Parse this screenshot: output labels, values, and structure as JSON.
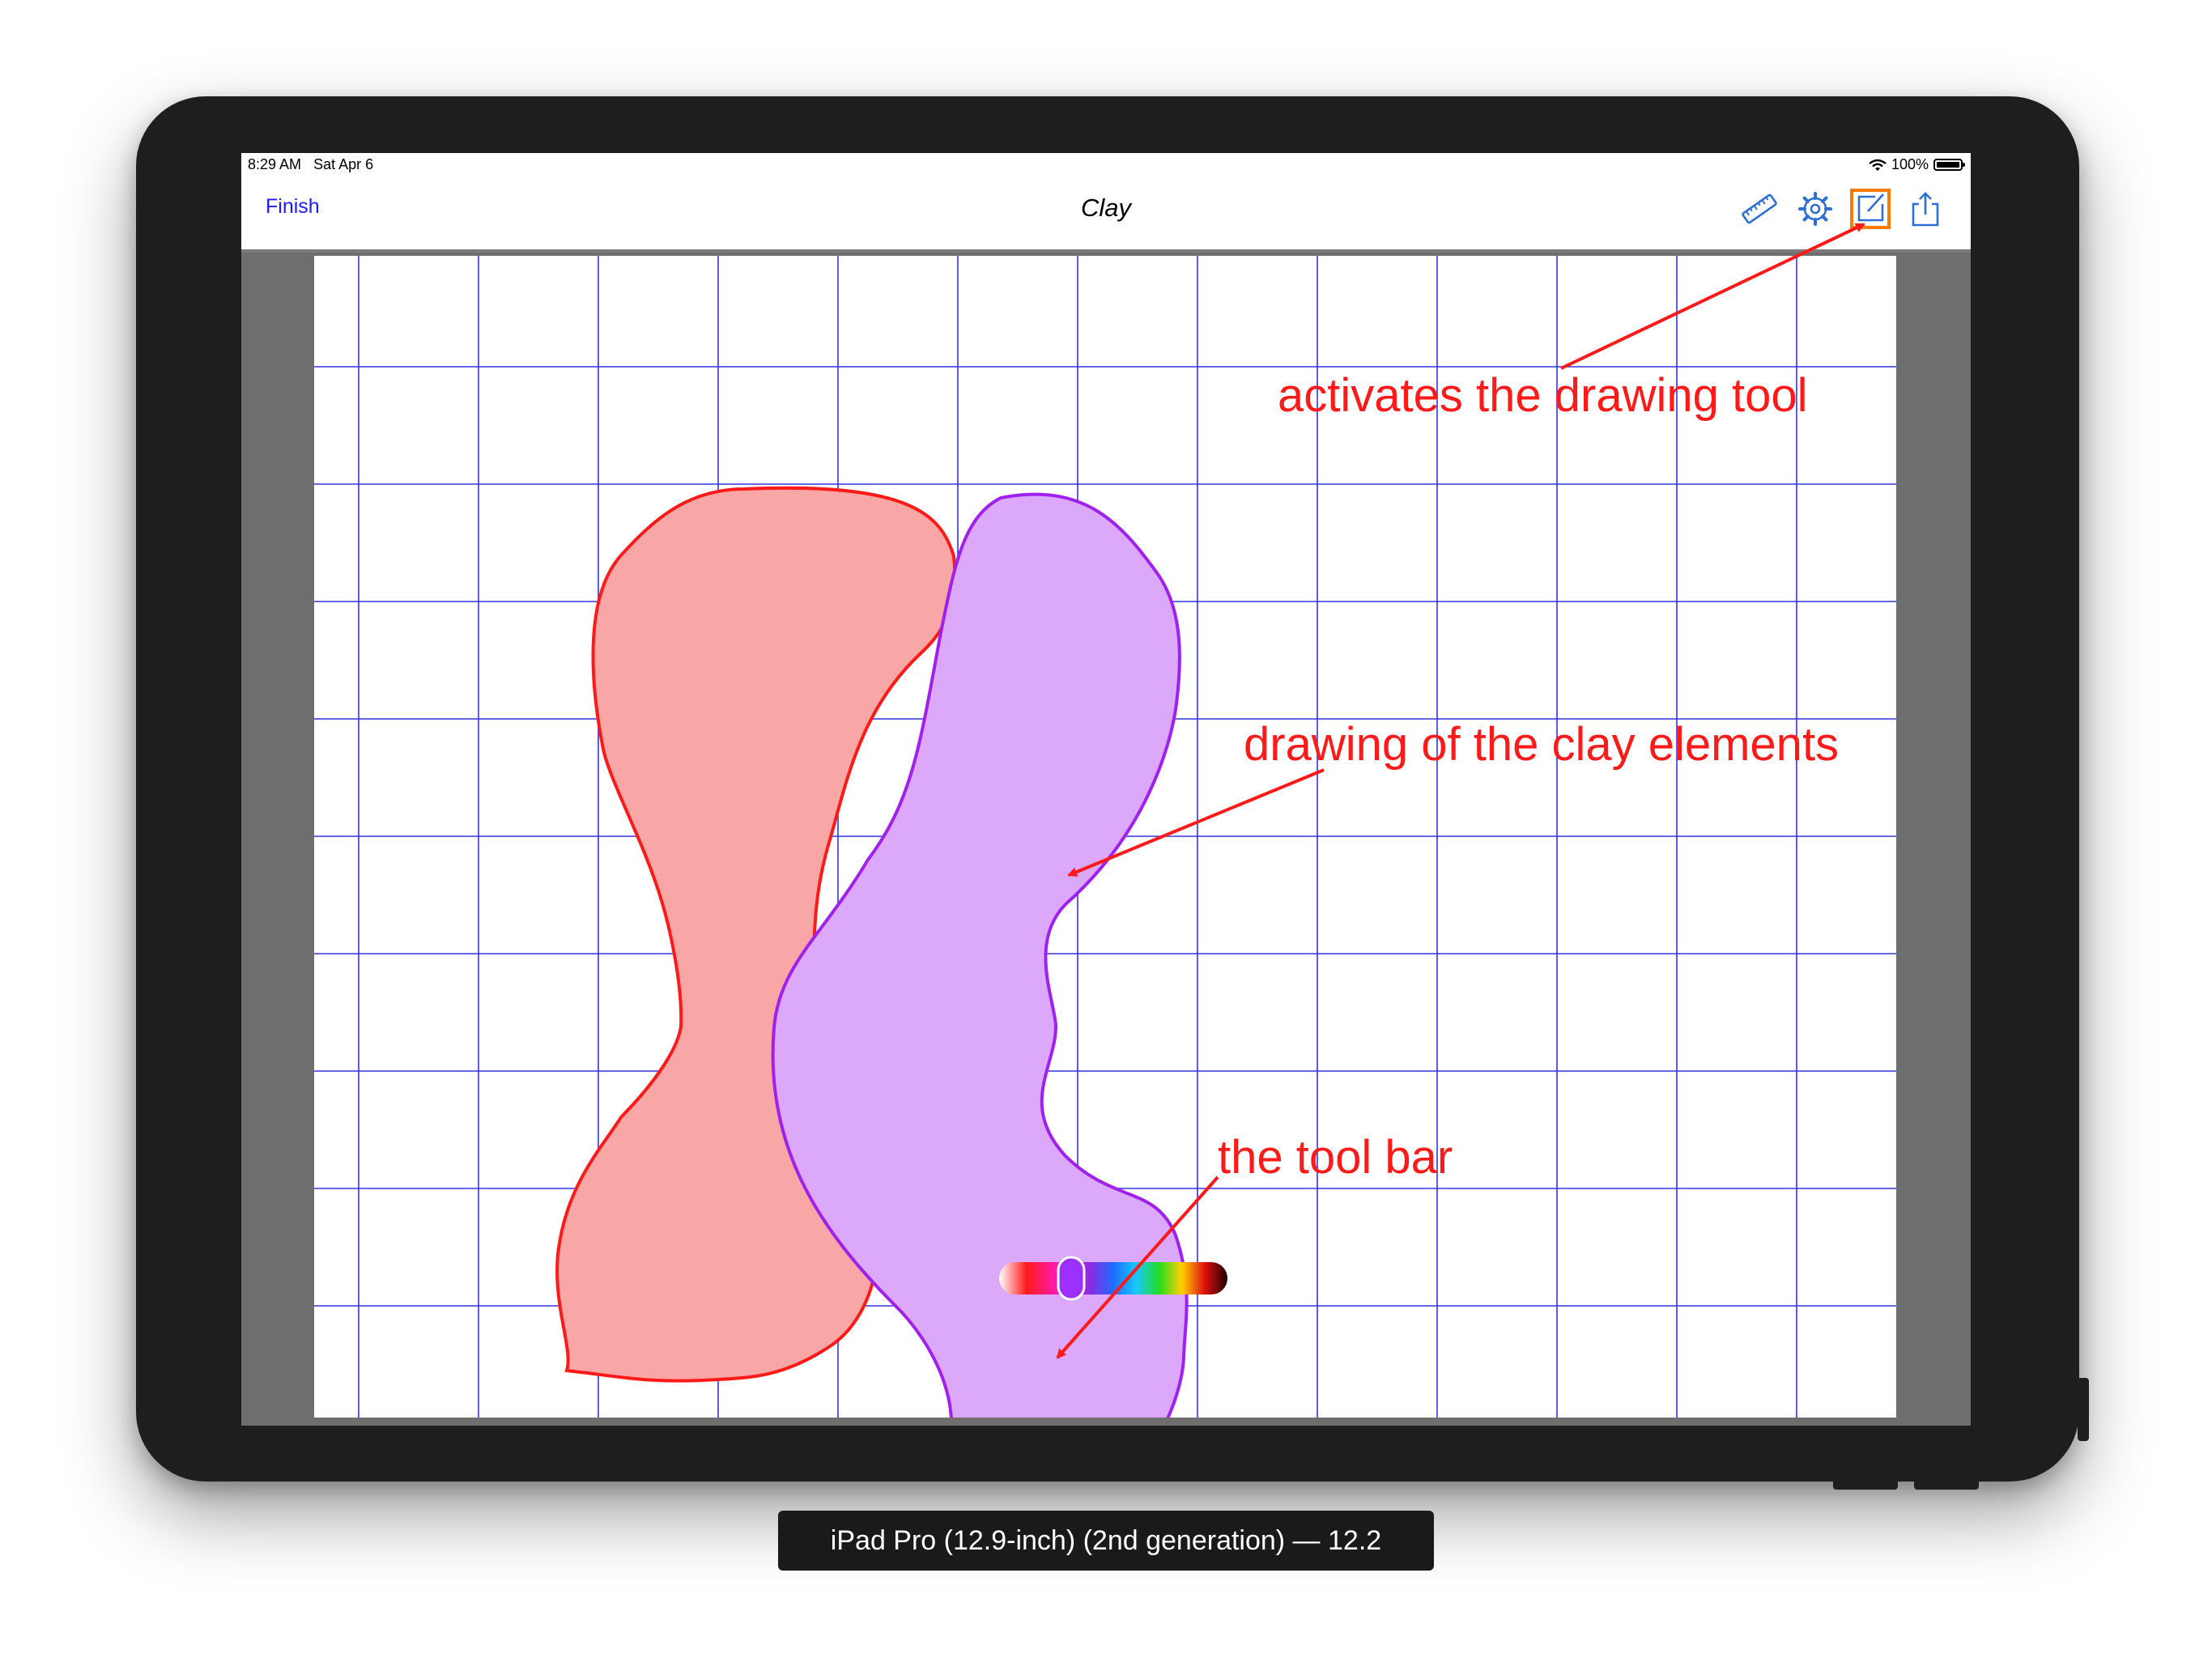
{
  "device_caption": "iPad Pro (12.9-inch) (2nd generation) — 12.2",
  "status_bar": {
    "time": "8:29 AM",
    "date": "Sat Apr 6",
    "battery": "100%"
  },
  "nav": {
    "finish_label": "Finish",
    "title": "Clay"
  },
  "icons": {
    "ruler": "ruler-icon",
    "settings": "gear-icon",
    "draw": "compose-icon",
    "share": "share-icon"
  },
  "toolbar": {
    "tools": [
      "color-wheel-icon",
      "eyedropper-icon",
      "link-icon",
      "undo-icon",
      "redo-icon",
      "trash-icon"
    ]
  },
  "canvas": {
    "grid_color": "#3333dd",
    "shapes": [
      {
        "name": "red clay element",
        "fill": "#f9a6a6",
        "stroke": "#ff1a1a"
      },
      {
        "name": "purple clay element",
        "fill": "#dca8fa",
        "stroke": "#a020f0"
      }
    ]
  },
  "color_slider": {
    "selected_color": "#9b30ff"
  },
  "annotations": {
    "drawing_tool": "activates the drawing tool",
    "clay_elements": "drawing of the clay elements",
    "tool_bar": "the tool bar"
  },
  "colors": {
    "annotation": "#ff1a1a",
    "link": "#1a1aff",
    "highlight": "#ff7a00",
    "icon": "#2d6fd6"
  }
}
